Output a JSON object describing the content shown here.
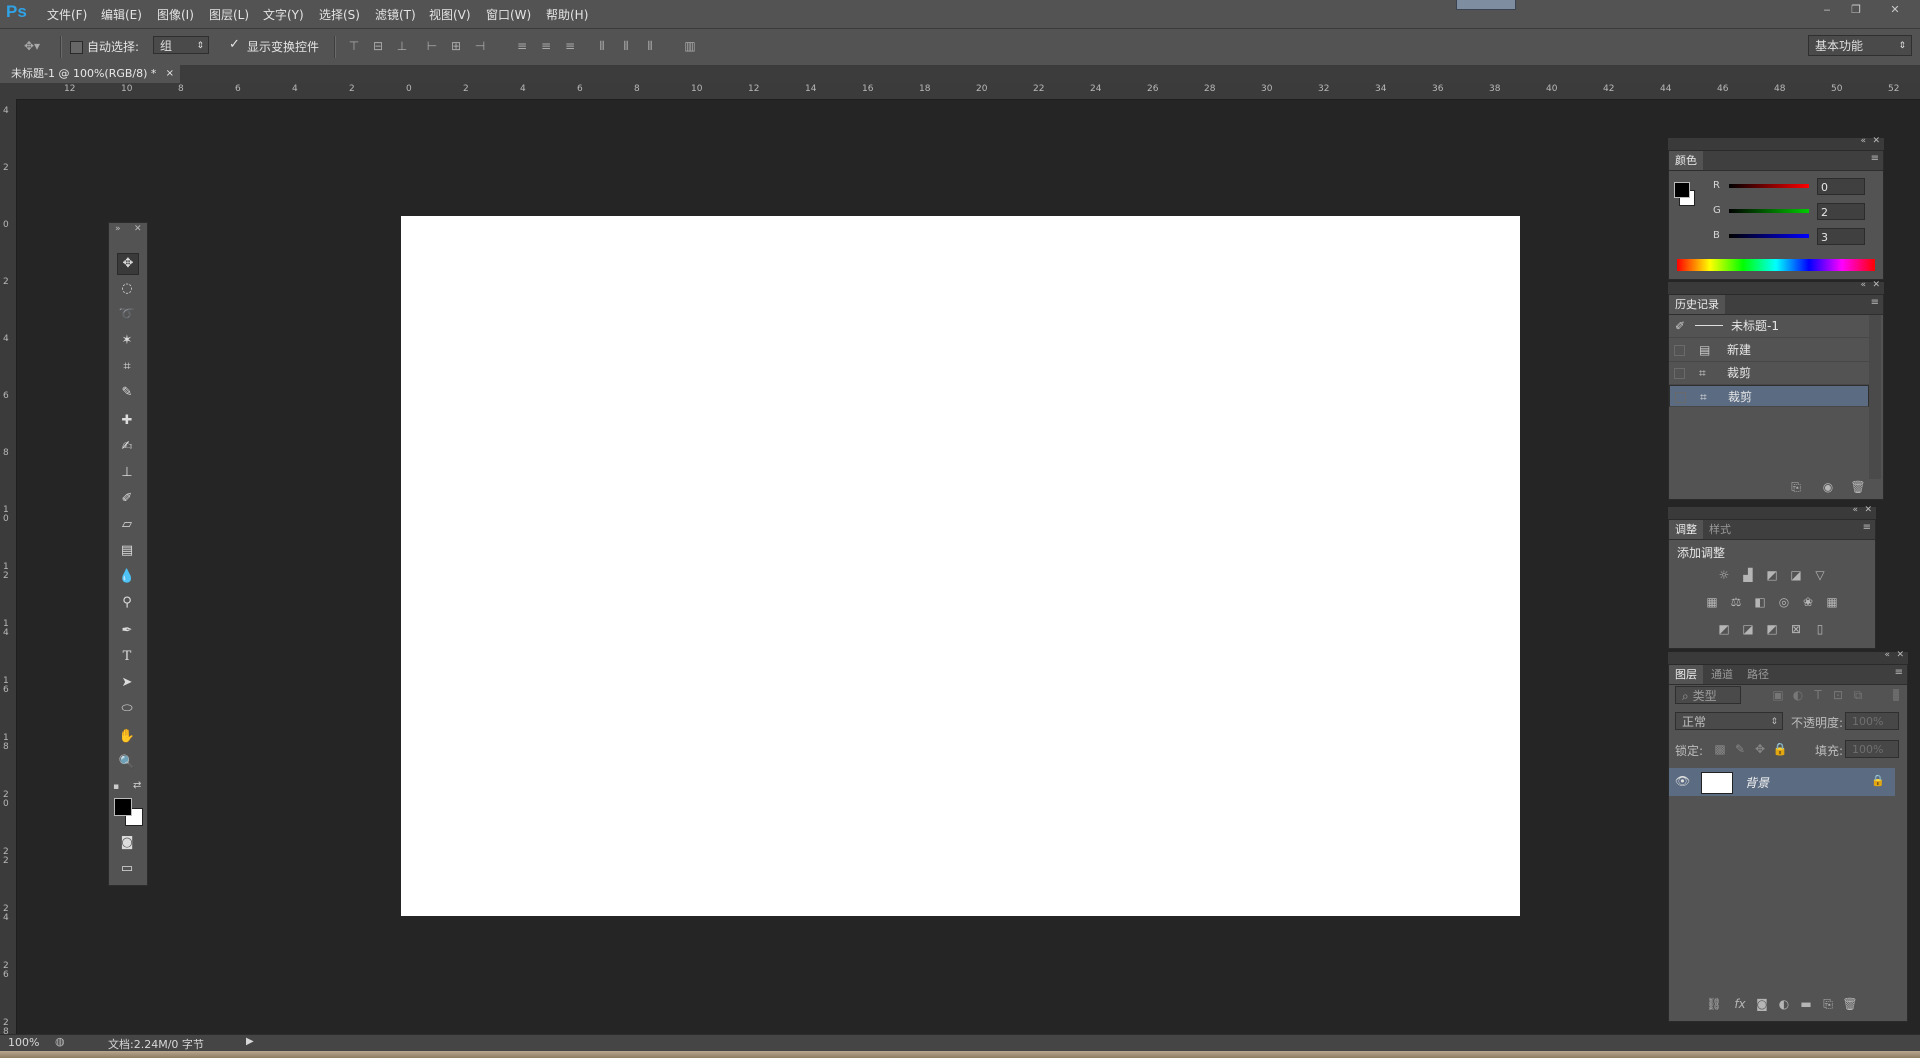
{
  "app": {
    "logo": "Ps"
  },
  "menu": [
    "文件(F)",
    "编辑(E)",
    "图像(I)",
    "图层(L)",
    "文字(Y)",
    "选择(S)",
    "滤镜(T)",
    "视图(V)",
    "窗口(W)",
    "帮助(H)"
  ],
  "options": {
    "auto_select_label": "自动选择:",
    "auto_select_value": "组",
    "show_transform_label": "显示变换控件",
    "workspace": "基本功能"
  },
  "document": {
    "tab_title": "未标题-1 @ 100%(RGB/8) *"
  },
  "ruler": {
    "h_labels": [
      "12",
      "10",
      "8",
      "6",
      "4",
      "2",
      "0",
      "2",
      "4",
      "6",
      "8",
      "10",
      "12",
      "14",
      "16",
      "18",
      "20",
      "22",
      "24",
      "26",
      "28",
      "30",
      "32",
      "34",
      "36",
      "38",
      "40",
      "42",
      "44",
      "46",
      "48",
      "50",
      "52"
    ],
    "v_labels": [
      "4",
      "2",
      "0",
      "2",
      "4",
      "6",
      "8",
      "10",
      "12",
      "14",
      "16",
      "18",
      "20",
      "22",
      "24",
      "26",
      "28"
    ]
  },
  "color_panel": {
    "tab": "颜色",
    "r_label": "R",
    "r_value": "0",
    "g_label": "G",
    "g_value": "2",
    "b_label": "B",
    "b_value": "3"
  },
  "history_panel": {
    "tab": "历史记录",
    "snapshot": "未标题-1",
    "items": [
      "新建",
      "裁剪",
      "裁剪"
    ]
  },
  "adjust_panel": {
    "tabs": [
      "调整",
      "样式"
    ],
    "title": "添加调整"
  },
  "layers_panel": {
    "tabs": [
      "图层",
      "通道",
      "路径"
    ],
    "filter_kind": "类型",
    "blend_mode": "正常",
    "opacity_label": "不透明度:",
    "opacity_value": "100%",
    "lock_label": "锁定:",
    "fill_label": "填充:",
    "fill_value": "100%",
    "layer_name": "背景"
  },
  "status": {
    "zoom": "100%",
    "doc_info": "文档:2.24M/0 字节"
  }
}
